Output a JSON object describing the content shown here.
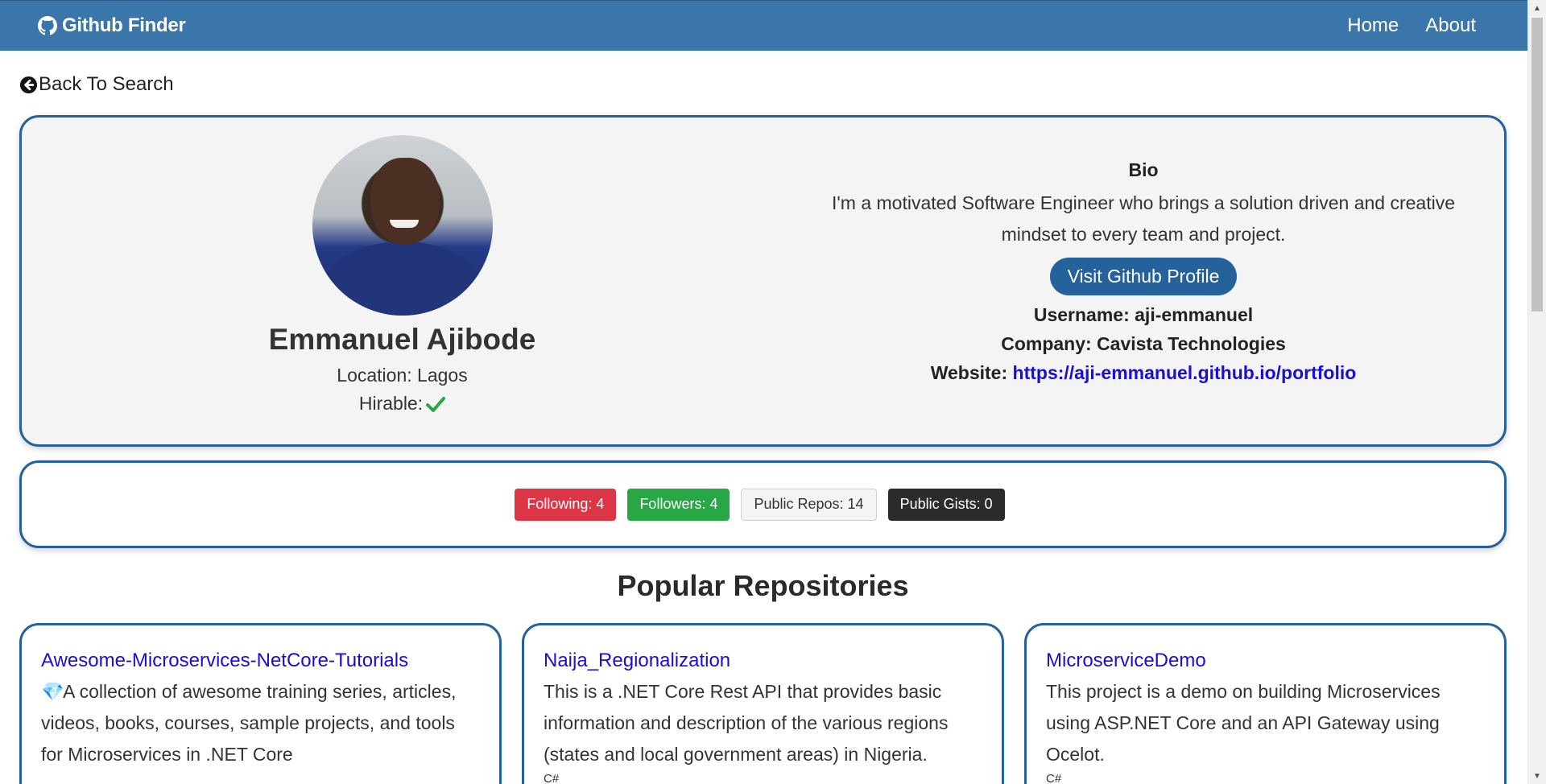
{
  "nav": {
    "brand": "Github Finder",
    "links": [
      "Home",
      "About"
    ]
  },
  "back_link": "Back To Search",
  "profile": {
    "name": "Emmanuel Ajibode",
    "location": "Location: Lagos",
    "hirable": "Hirable:",
    "bio_heading": "Bio",
    "bio": "I'm a motivated Software Engineer who brings a solution driven and creative mindset to every team and project.",
    "visit_button": "Visit Github Profile",
    "username": "Username: aji-emmanuel",
    "company": "Company: Cavista Technologies",
    "website_label": "Website:",
    "website_url": "https://aji-emmanuel.github.io/portfolio"
  },
  "stats": {
    "following": "Following: 4",
    "followers": "Followers: 4",
    "public_repos": "Public Repos: 14",
    "public_gists": "Public Gists: 0"
  },
  "repos_title": "Popular Repositories",
  "repos": [
    {
      "name": "Awesome-Microservices-NetCore-Tutorials",
      "gem": "💎",
      "description": "A collection of awesome training series, articles, videos, books, courses, sample projects, and tools for Microservices in .NET Core",
      "language": ""
    },
    {
      "name": "Naija_Regionalization",
      "description": "This is a .NET Core Rest API that provides basic information and description of the various regions (states and local government areas) in Nigeria.",
      "language": "C#"
    },
    {
      "name": "MicroserviceDemo",
      "description": "This project is a demo on building Microservices using ASP.NET Core and an API Gateway using Ocelot.",
      "language": "C#"
    }
  ],
  "colors": {
    "navbar": "#3a76aa",
    "accent": "#25619a",
    "link": "#1a0dd6",
    "success": "#28a745",
    "danger": "#dc3545",
    "dark": "#2b2b2b"
  }
}
